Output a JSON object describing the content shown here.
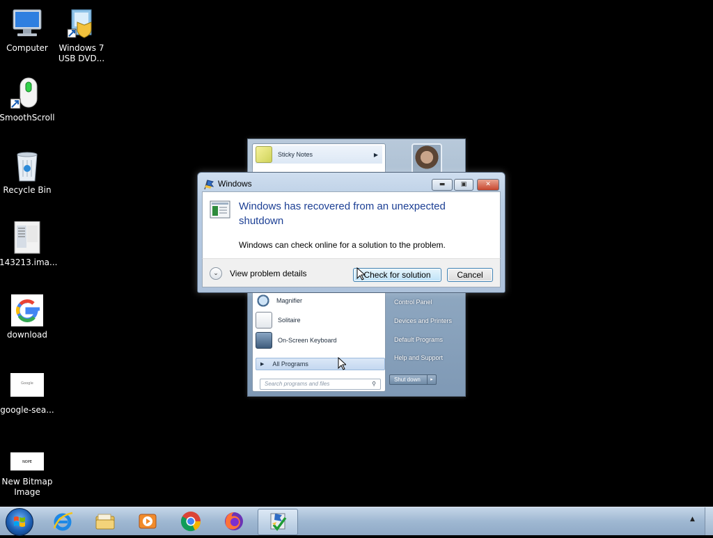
{
  "desktop": {
    "icons": [
      {
        "label": "Computer"
      },
      {
        "label": "Windows 7 USB DVD..."
      },
      {
        "label": "SmoothScroll"
      },
      {
        "label": "Recycle Bin"
      },
      {
        "label": "143213.ima..."
      },
      {
        "label": "download"
      },
      {
        "label": "google-sea..."
      },
      {
        "label": "New Bitmap Image"
      }
    ],
    "thumbnail_text": {
      "nope": "NOPE",
      "google": "Google"
    }
  },
  "start_menu": {
    "programs": [
      {
        "label": "Sticky Notes"
      },
      {
        "label": "Magnifier"
      },
      {
        "label": "Solitaire"
      },
      {
        "label": "On-Screen Keyboard"
      }
    ],
    "all_programs": "All Programs",
    "search_placeholder": "Search programs and files",
    "right_items": [
      {
        "label": "Control Panel"
      },
      {
        "label": "Devices and Printers"
      },
      {
        "label": "Default Programs"
      },
      {
        "label": "Help and Support"
      }
    ],
    "shutdown": "Shut down"
  },
  "dialog": {
    "title": "Windows",
    "heading": "Windows has recovered from an unexpected shutdown",
    "message": "Windows can check online for a solution to the problem.",
    "details_toggle": "View problem details",
    "check_button": "Check for solution",
    "cancel_button": "Cancel"
  },
  "taskbar": {
    "pinned": [
      "internet-explorer",
      "windows-explorer",
      "windows-media-player",
      "google-chrome",
      "firefox",
      "problem-reports"
    ],
    "active": "problem-reports"
  },
  "colors": {
    "desktop_bg": "#000000",
    "dialog_heading": "#1c3f94",
    "taskbar": "#9fb8d2"
  }
}
